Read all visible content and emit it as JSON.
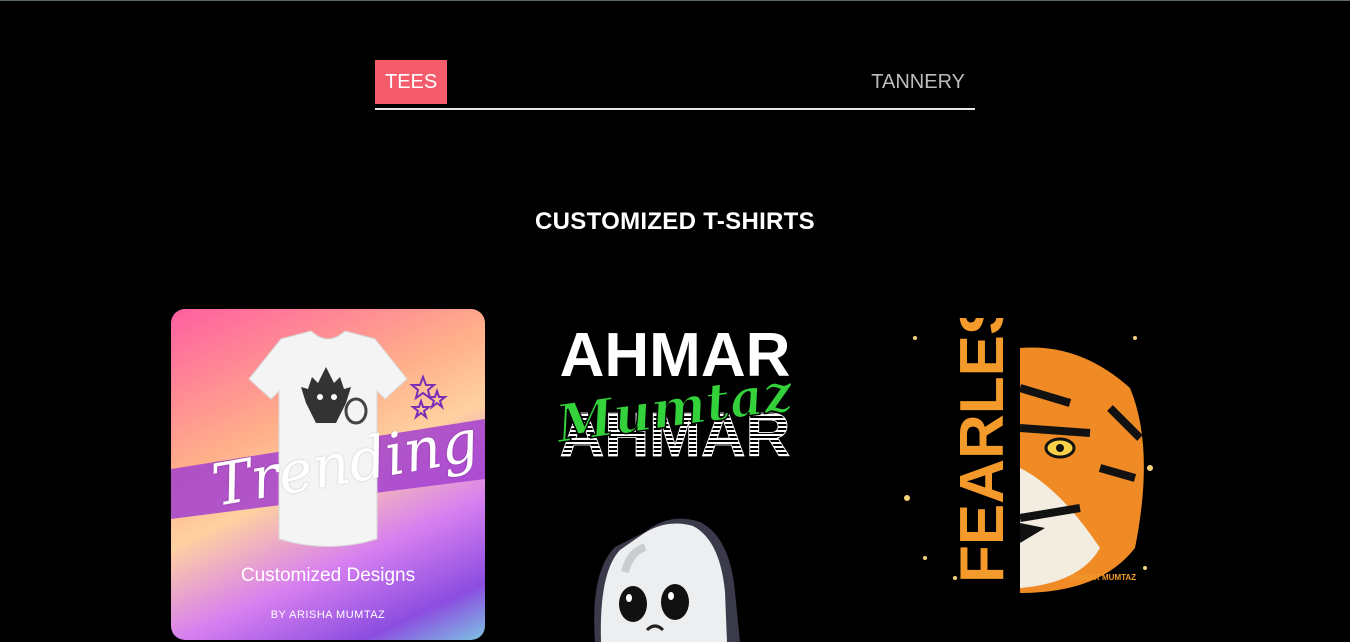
{
  "tabs": [
    {
      "label": "TEES",
      "active": true
    },
    {
      "label": "TANNERY",
      "active": false
    }
  ],
  "section": {
    "title_part1": "CUSTOMIZED ",
    "title_part2": "T-SHIRTS"
  },
  "cards": {
    "trending": {
      "script_text": "Trending",
      "subtitle": "Customized Designs",
      "byline": "BY ARISHA MUMTAZ"
    },
    "ahmar": {
      "top": "AHMAR",
      "script": "Mumtaz",
      "bottom": "AHMAR"
    },
    "fearless": {
      "word": "FEARLESS",
      "signature": "AHMAR MUMTAZ"
    }
  },
  "colors": {
    "accent": "#f45b6b",
    "background": "#000000",
    "green": "#33d13a",
    "orange": "#f39a2b"
  }
}
